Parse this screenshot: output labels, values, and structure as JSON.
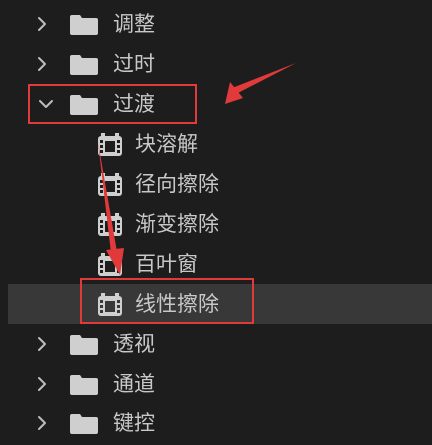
{
  "tree": {
    "items": [
      {
        "label": "调整",
        "kind": "folder",
        "expanded": false
      },
      {
        "label": "过时",
        "kind": "folder",
        "expanded": false
      },
      {
        "label": "过渡",
        "kind": "folder",
        "expanded": true
      },
      {
        "label": "块溶解",
        "kind": "effect"
      },
      {
        "label": "径向擦除",
        "kind": "effect"
      },
      {
        "label": "渐变擦除",
        "kind": "effect"
      },
      {
        "label": "百叶窗",
        "kind": "effect"
      },
      {
        "label": "线性擦除",
        "kind": "effect",
        "selected": true
      },
      {
        "label": "透视",
        "kind": "folder",
        "expanded": false
      },
      {
        "label": "通道",
        "kind": "folder",
        "expanded": false
      },
      {
        "label": "键控",
        "kind": "folder",
        "expanded": false
      }
    ]
  },
  "annotations": {
    "highlight_color": "#e03a3a"
  },
  "colors": {
    "background": "#1d1d1d",
    "selected_row": "#383838",
    "text": "#c8c8c8",
    "icon": "#cfcfcf"
  }
}
